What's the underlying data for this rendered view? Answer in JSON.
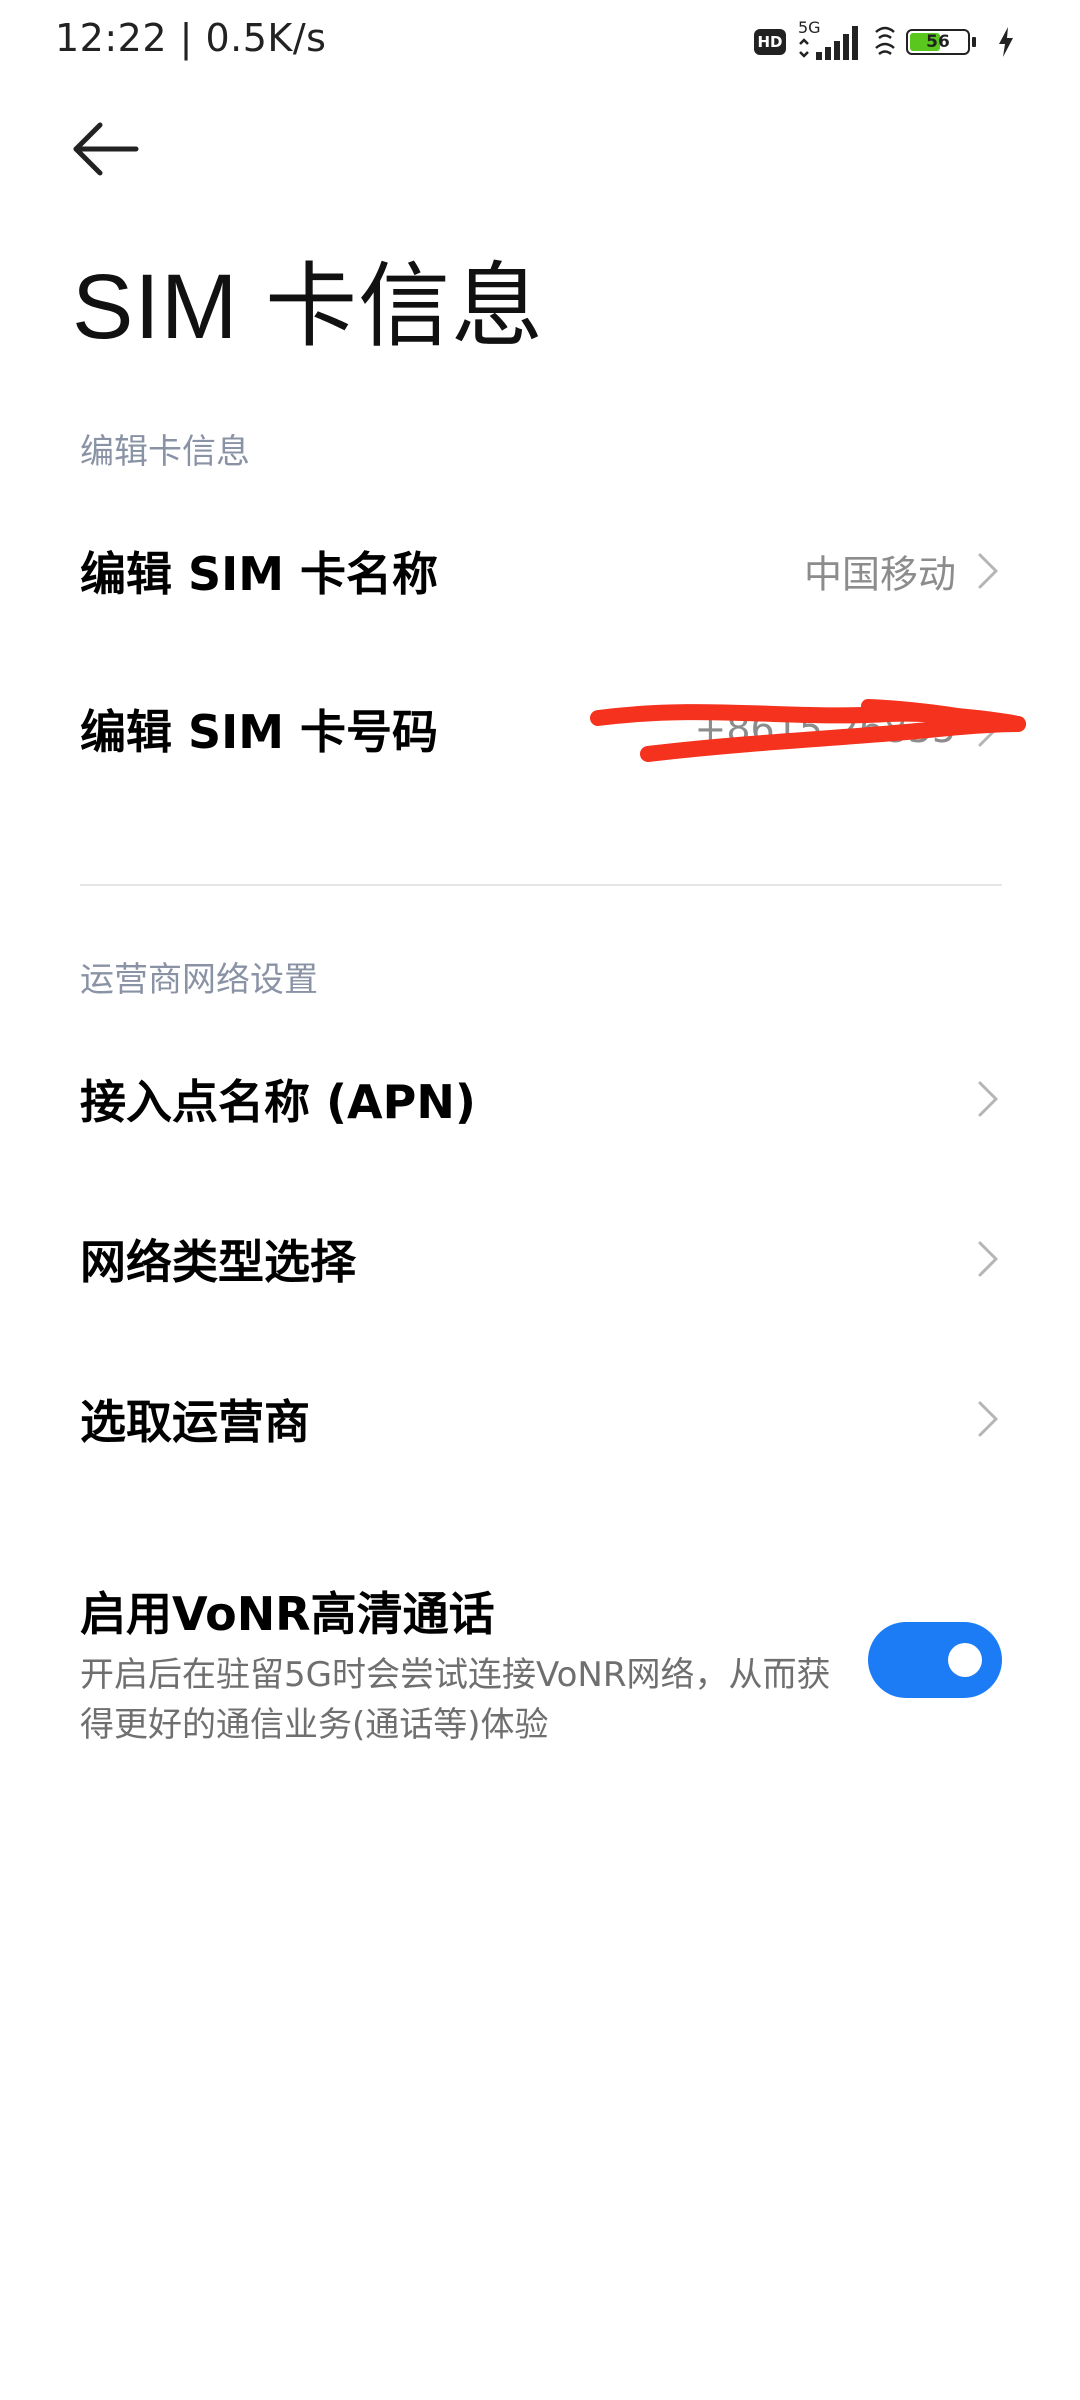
{
  "status_bar": {
    "time": "12:22 | 0.5K/s",
    "hd_label": "HD",
    "network_label": "5G",
    "battery_level": "56",
    "battery_percent": 56,
    "charging": true,
    "icons": [
      "hd-icon",
      "signal-5g-icon",
      "battery-icon",
      "charging-bolt-icon"
    ]
  },
  "header": {
    "back_icon": "arrow-left-icon",
    "title": "SIM 卡信息"
  },
  "sections": {
    "edit_card": {
      "header": "编辑卡信息",
      "items": [
        {
          "label": "编辑 SIM 卡名称",
          "value": "中国移动"
        },
        {
          "label": "编辑 SIM 卡号码",
          "value": "+8615 26835"
        }
      ]
    },
    "carrier_network": {
      "header": "运营商网络设置",
      "items": [
        {
          "label": "接入点名称 (APN)"
        },
        {
          "label": "网络类型选择"
        },
        {
          "label": "选取运营商"
        }
      ]
    }
  },
  "vonr": {
    "title": "启用VoNR高清通话",
    "description": "开启后在驻留5G时会尝试连接VoNR网络，从而获得更好的通信业务(通话等)体验",
    "enabled": true
  },
  "colors": {
    "accent": "#1b7cf5",
    "section_header": "#8a93a6",
    "value_text": "#8c8c8c",
    "redaction": "#f5321e",
    "battery_fill": "#5ac71e"
  }
}
